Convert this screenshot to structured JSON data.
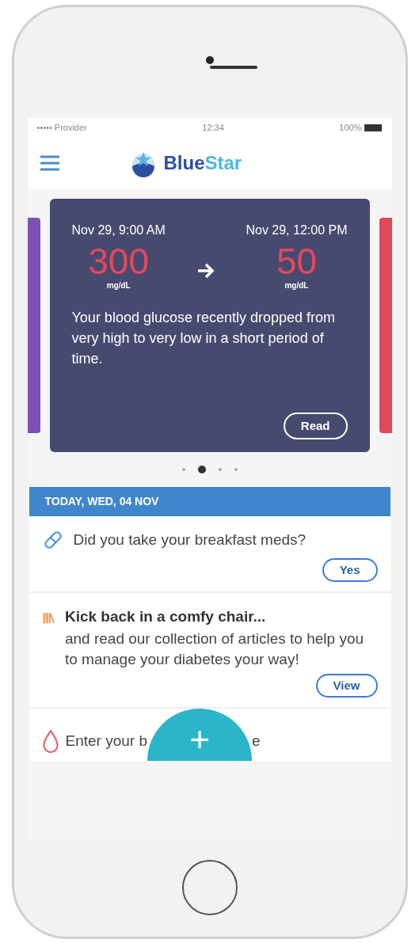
{
  "status_bar": {
    "carrier": "••••• Provider",
    "time": "12:34",
    "battery": "100%"
  },
  "header": {
    "logo_text_dark": "Blue",
    "logo_text_light": "Star"
  },
  "carousel": {
    "prev_card": {
      "color": "#7b52ae"
    },
    "next_card": {
      "color": "#e04a5c"
    },
    "card": {
      "from_time": "Nov 29, 9:00 AM",
      "from_value": "300",
      "from_unit": "mg/dL",
      "to_time": "Nov 29, 12:00 PM",
      "to_value": "50",
      "to_unit": "mg/dL",
      "message": "Your blood glucose recently dropped from very high to very low in a short period of time.",
      "button": "Read"
    },
    "dots": [
      {
        "selected": false
      },
      {
        "selected": true
      },
      {
        "selected": false
      },
      {
        "selected": false
      }
    ]
  },
  "day_header": "TODAY, WED, 04 NOV",
  "feed": [
    {
      "kind": "meds",
      "title": "Did you take your breakfast meds?",
      "button": "Yes"
    },
    {
      "kind": "article",
      "title": "Kick back in a comfy chair...",
      "body": "and read our collection of articles to help you to manage your diabetes your way!",
      "button": "View"
    },
    {
      "kind": "glucose",
      "title_before": "Enter your b",
      "title_after": "e"
    }
  ],
  "fab": {
    "label": "+"
  }
}
